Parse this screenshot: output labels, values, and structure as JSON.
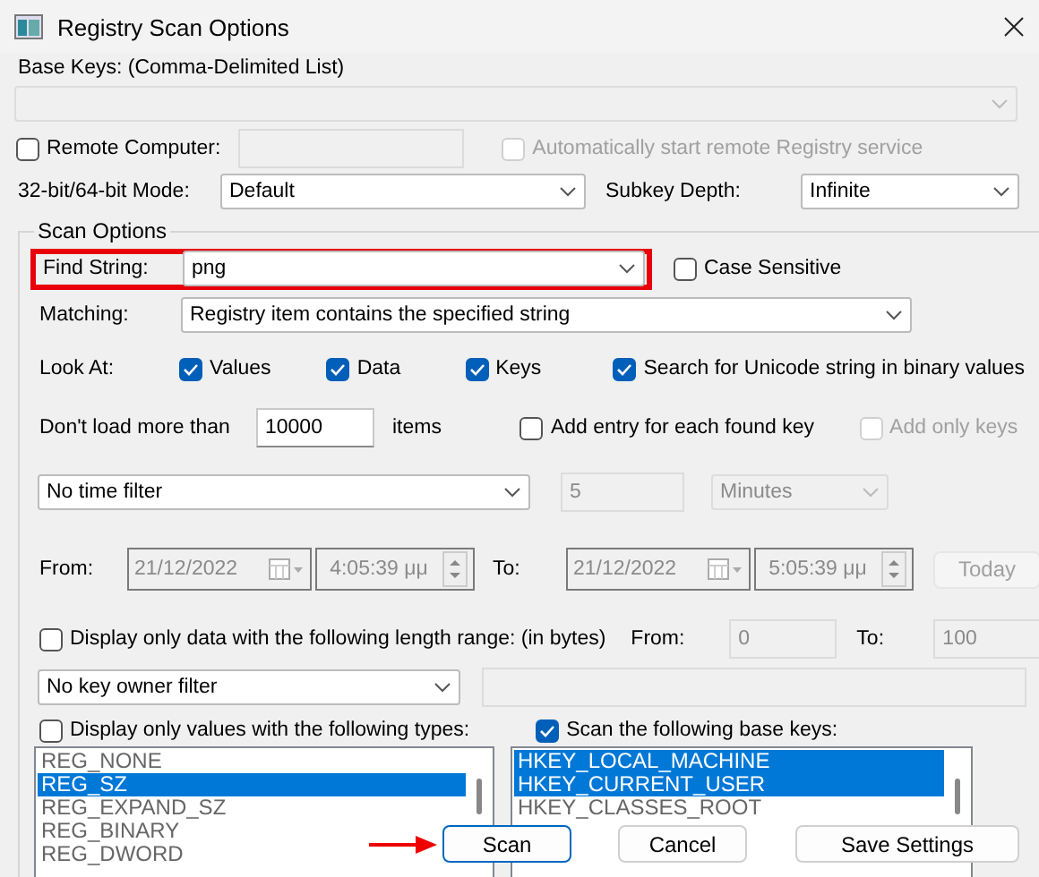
{
  "window": {
    "title": "Registry Scan Options"
  },
  "base_keys": {
    "label": "Base Keys:  (Comma-Delimited List)"
  },
  "remote": {
    "label": "Remote Computer:",
    "checked": false
  },
  "auto_start": {
    "label": "Automatically start remote Registry service",
    "checked": false,
    "disabled": true
  },
  "mode": {
    "label": "32-bit/64-bit Mode:",
    "value": "Default"
  },
  "subkey_depth": {
    "label": "Subkey Depth:",
    "value": "Infinite"
  },
  "scan_options": {
    "title": "Scan Options",
    "find_string": {
      "label": "Find String:",
      "value": "png",
      "highlighted": true
    },
    "case_sensitive": {
      "label": "Case Sensitive",
      "checked": false
    },
    "matching": {
      "label": "Matching:",
      "value": "Registry item contains the specified string"
    },
    "look_at": {
      "label": "Look At:",
      "options": [
        {
          "label": "Values",
          "checked": true
        },
        {
          "label": "Data",
          "checked": true
        },
        {
          "label": "Keys",
          "checked": true
        }
      ]
    },
    "unicode": {
      "label": "Search for Unicode string in binary values",
      "checked": true
    },
    "limit": {
      "label": "Don't load more than",
      "value": "10000",
      "unit": "items"
    },
    "add_entry": {
      "label": "Add entry for each found key",
      "checked": false
    },
    "add_only_keys": {
      "label": "Add only keys",
      "checked": false,
      "disabled": true
    },
    "time_filter": {
      "value": "No time filter",
      "amount": "5",
      "unit": "Minutes"
    },
    "from": {
      "label": "From:",
      "date": "21/12/2022",
      "time": "4:05:39 μμ"
    },
    "to": {
      "label": "To:",
      "date": "21/12/2022",
      "time": "5:05:39 μμ"
    },
    "today": {
      "label": "Today",
      "disabled": true
    },
    "length_range": {
      "label": "Display only data with the following length range: (in bytes)",
      "checked": false,
      "from_label": "From:",
      "from": "0",
      "to_label": "To:",
      "to": "100"
    },
    "key_owner": {
      "value": "No key owner filter"
    },
    "value_types": {
      "label": "Display only values with the following types:",
      "checked": false,
      "items": [
        {
          "label": "REG_NONE",
          "selected": false
        },
        {
          "label": "REG_SZ",
          "selected": true
        },
        {
          "label": "REG_EXPAND_SZ",
          "selected": false
        },
        {
          "label": "REG_BINARY",
          "selected": false
        },
        {
          "label": "REG_DWORD",
          "selected": false
        }
      ]
    },
    "scan_keys": {
      "label": "Scan the following base keys:",
      "checked": true,
      "items": [
        {
          "label": "HKEY_LOCAL_MACHINE",
          "selected": true
        },
        {
          "label": "HKEY_CURRENT_USER",
          "selected": true
        },
        {
          "label": "HKEY_CLASSES_ROOT",
          "selected": false
        }
      ]
    }
  },
  "buttons": [
    {
      "label": "Scan",
      "focused": true
    },
    {
      "label": "Cancel",
      "focused": false
    },
    {
      "label": "Save Settings",
      "focused": false
    }
  ]
}
